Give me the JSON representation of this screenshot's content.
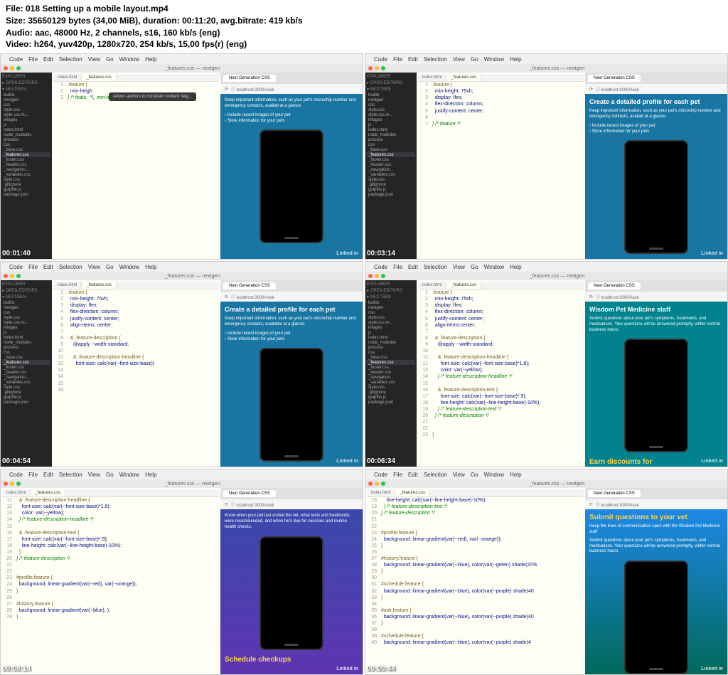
{
  "file_info": {
    "line1": "File: 018 Setting up a mobile layout.mp4",
    "line2": "Size: 35650129 bytes (34,00 MiB), duration: 00:11:20, avg.bitrate: 419 kb/s",
    "line3": "Audio: aac, 48000 Hz, 2 channels, s16, 160 kb/s (eng)",
    "line4": "Video: h264, yuv420p, 1280x720, 254 kb/s, 15,00 fps(r) (eng)"
  },
  "menu": [
    "Code",
    "File",
    "Edit",
    "Selection",
    "View",
    "Go",
    "Window",
    "Help"
  ],
  "window_title": "_features.css — nextgen",
  "sidebar": {
    "explorer": "EXPLORER",
    "open_editors": "OPEN EDITORS",
    "project": "NEXTGEN",
    "items": [
      "builds",
      "nextgen",
      "css",
      "style.css",
      "style.css.m...",
      "images",
      "js",
      "index.html",
      "node_modules",
      "process",
      "css",
      "_base.css",
      "_features.css",
      "_footer.css",
      "_header.css",
      "_navigation...",
      "_variables.css",
      "style.css",
      ".gitignore",
      "gulpfile.js",
      "package.json"
    ]
  },
  "tabs": {
    "html": "index.html",
    "css": "_features.css"
  },
  "browser": {
    "tab": "Next Generation CSS",
    "url": "localhost:3000/#ask"
  },
  "shots": [
    {
      "ts": "00:01:40",
      "code": [
        {
          "n": "1",
          "t": ".feature {",
          "c": "sel"
        },
        {
          "n": "2",
          "t": "  min-heigh",
          "c": "prop"
        },
        {
          "n": "3",
          "t": "} /* featu  🔧 min-height",
          "c": "com"
        }
      ],
      "tooltip": "Allows authors to constrain content heig...",
      "bcolor": "#1976a3",
      "bc_title": "",
      "bc_text": "Keep important information, such as your pet's microchip number and emergency contacts, availab at a glance.",
      "bc_list": [
        "Include recent images of your pet",
        "Store information for your pets"
      ]
    },
    {
      "ts": "00:03:14",
      "code": [
        {
          "n": "1",
          "t": ".feature {",
          "c": "sel"
        },
        {
          "n": "2",
          "t": "  min-height: 75vh;",
          "c": "prop"
        },
        {
          "n": "3",
          "t": "  display: flex;",
          "c": "prop"
        },
        {
          "n": "4",
          "t": "  flex-direction: column;",
          "c": "prop"
        },
        {
          "n": "5",
          "t": "  justify-content: center;",
          "c": "prop"
        },
        {
          "n": "6",
          "t": "",
          "c": ""
        },
        {
          "n": "7",
          "t": "} /* feature */",
          "c": "com"
        }
      ],
      "bcolor": "#1976a3",
      "bc_title": "Create a detailed profile for each pet",
      "bc_text": "Keep important information, such as your pet's microchip number and emergency contacts, availab at a glance.",
      "bc_list": [
        "Include recent images of your pet",
        "Store information for your pets"
      ]
    },
    {
      "ts": "00:04:54",
      "code": [
        {
          "n": "1",
          "t": ".feature {",
          "c": "sel"
        },
        {
          "n": "2",
          "t": "  min-height: 75vh;",
          "c": "prop"
        },
        {
          "n": "3",
          "t": "  display: flex;",
          "c": "prop"
        },
        {
          "n": "4",
          "t": "  flex-direction: column;",
          "c": "prop"
        },
        {
          "n": "5",
          "t": "  justify-content: center;",
          "c": "prop"
        },
        {
          "n": "6",
          "t": "  align-items: center;",
          "c": "prop"
        },
        {
          "n": "7",
          "t": "",
          "c": ""
        },
        {
          "n": "8",
          "t": "  & .feature-description {",
          "c": "sel"
        },
        {
          "n": "9",
          "t": "    @apply --width-standard;",
          "c": "prop"
        },
        {
          "n": "10",
          "t": "",
          "c": ""
        },
        {
          "n": "11",
          "t": "    & .feature-description-headline {",
          "c": "sel"
        },
        {
          "n": "12",
          "t": "      font-size: calc(var(--font-size-base))",
          "c": "prop"
        },
        {
          "n": "13",
          "t": "",
          "c": ""
        },
        {
          "n": "14",
          "t": "",
          "c": ""
        },
        {
          "n": "15",
          "t": "",
          "c": ""
        },
        {
          "n": "16",
          "t": "",
          "c": ""
        }
      ],
      "bcolor": "#1976a3",
      "bc_title": "Create a detailed profile for each pet",
      "bc_text": "Keep important information, such as your pet's microchip number and emergency contacts, available at a glance.",
      "bc_list": [
        "Include recent images of your pet",
        "Store information for your pets"
      ]
    },
    {
      "ts": "00:06:34",
      "code": [
        {
          "n": "1",
          "t": ".feature {",
          "c": "sel"
        },
        {
          "n": "2",
          "t": "  min-height: 75vh;",
          "c": "prop"
        },
        {
          "n": "3",
          "t": "  display: flex;",
          "c": "prop"
        },
        {
          "n": "4",
          "t": "  flex-direction: column;",
          "c": "prop"
        },
        {
          "n": "5",
          "t": "  justify-content: center;",
          "c": "prop"
        },
        {
          "n": "6",
          "t": "  align-items:center;",
          "c": "prop"
        },
        {
          "n": "7",
          "t": "",
          "c": ""
        },
        {
          "n": "8",
          "t": "  & .feature-description {",
          "c": "sel"
        },
        {
          "n": "9",
          "t": "    @apply --width-standard;",
          "c": "prop"
        },
        {
          "n": "10",
          "t": "",
          "c": ""
        },
        {
          "n": "11",
          "t": "    & .feature-description-headline {",
          "c": "sel"
        },
        {
          "n": "12",
          "t": "      font-size: calc(var(--font-size-base)*1.8);",
          "c": "prop"
        },
        {
          "n": "13",
          "t": "      color: var(--yellow);",
          "c": "prop"
        },
        {
          "n": "14",
          "t": "    } /* feature-description-headline */",
          "c": "com"
        },
        {
          "n": "15",
          "t": "",
          "c": ""
        },
        {
          "n": "16",
          "t": "    & .feature-description-text {",
          "c": "sel"
        },
        {
          "n": "17",
          "t": "      font-size: calc(var(--font-size-base)*.9);",
          "c": "prop"
        },
        {
          "n": "18",
          "t": "      line-height: calc(var(--line-height-base)-10%);",
          "c": "prop"
        },
        {
          "n": "19",
          "t": "    } /* feature-description-text */",
          "c": "com"
        },
        {
          "n": "20",
          "t": "  } /* feature-description */",
          "c": "com"
        },
        {
          "n": "21",
          "t": "",
          "c": ""
        },
        {
          "n": "22",
          "t": "",
          "c": ""
        },
        {
          "n": "23",
          "t": "}",
          "c": "sel"
        }
      ],
      "bcolor": "#00838f",
      "bc_title": "Wisdom Pet Medicine staff",
      "bc_text": "Submit questions about your pet's symptoms, treatments, and medications. Your questions will be answered promptly, within normal business hours.",
      "bc_list": [],
      "bc_footer": "Earn discounts for"
    },
    {
      "ts": "00:08:14",
      "no_sidebar": true,
      "code": [
        {
          "n": "11",
          "t": "  & .feature-description-headline {",
          "c": "sel"
        },
        {
          "n": "12",
          "t": "    font-size: calc(var(--font-size-base)*1.8);",
          "c": "prop"
        },
        {
          "n": "13",
          "t": "    color: var(--yellow);",
          "c": "prop"
        },
        {
          "n": "14",
          "t": "  } /* feature-description-headline */",
          "c": "com"
        },
        {
          "n": "15",
          "t": "",
          "c": ""
        },
        {
          "n": "16",
          "t": "  & .feature-description-text {",
          "c": "sel"
        },
        {
          "n": "17",
          "t": "    font-size: calc(var(--font-size-base)*.9);",
          "c": "prop"
        },
        {
          "n": "18",
          "t": "    line-height: calc(var(--line-height-base)-10%);",
          "c": "prop"
        },
        {
          "n": "19",
          "t": "  }",
          "c": "sel"
        },
        {
          "n": "20",
          "t": "} /* feature-description */",
          "c": "com"
        },
        {
          "n": "21",
          "t": "",
          "c": ""
        },
        {
          "n": "22",
          "t": "",
          "c": ""
        },
        {
          "n": "23",
          "t": "#profile.feature {",
          "c": "sel"
        },
        {
          "n": "24",
          "t": "  background: linear-gradient(var(--red), var(--orange));",
          "c": "prop"
        },
        {
          "n": "25",
          "t": "}",
          "c": "sel"
        },
        {
          "n": "26",
          "t": "",
          "c": ""
        },
        {
          "n": "27",
          "t": "#history.feature {",
          "c": "sel"
        },
        {
          "n": "28",
          "t": "  background: linear-gradient(var(--blue), );",
          "c": "prop"
        },
        {
          "n": "29",
          "t": "}",
          "c": "sel"
        }
      ],
      "bcolor": "linear-gradient(#3949ab,#5e35b1)",
      "bc_text": "Know when your pet last visited the vet, what tests and treatments were recommended, and when he's due for vaccines and routine health checks.",
      "bc_footer_yellow": "Schedule checkups"
    },
    {
      "ts": "00:09:44",
      "no_sidebar": true,
      "code": [
        {
          "n": "18",
          "t": "    line-height: calc(var(--line-height-base)-10%);",
          "c": "prop"
        },
        {
          "n": "19",
          "t": "  } /* feature-description-text */",
          "c": "com"
        },
        {
          "n": "20",
          "t": "} /* feature-description */",
          "c": "com"
        },
        {
          "n": "21",
          "t": "",
          "c": ""
        },
        {
          "n": "22",
          "t": "",
          "c": ""
        },
        {
          "n": "23",
          "t": "#profile.feature {",
          "c": "sel"
        },
        {
          "n": "24",
          "t": "  background: linear-gradient(var(--red), var(--orange));",
          "c": "prop"
        },
        {
          "n": "25",
          "t": "}",
          "c": "sel"
        },
        {
          "n": "26",
          "t": "",
          "c": ""
        },
        {
          "n": "27",
          "t": "#history.feature {",
          "c": "sel"
        },
        {
          "n": "28",
          "t": "  background: linear-gradient(var(--blue), color(var(--green) shade(20%",
          "c": "prop"
        },
        {
          "n": "29",
          "t": "}",
          "c": "sel"
        },
        {
          "n": "30",
          "t": "",
          "c": ""
        },
        {
          "n": "31",
          "t": "#schedule.feature {",
          "c": "sel"
        },
        {
          "n": "32",
          "t": "  background: linear-gradient(var(--blue), color(var(--purple) shade(40",
          "c": "prop"
        },
        {
          "n": "33",
          "t": "}",
          "c": "sel"
        },
        {
          "n": "34",
          "t": "",
          "c": ""
        },
        {
          "n": "35",
          "t": "#ask.feature {",
          "c": "sel"
        },
        {
          "n": "36",
          "t": "  background: linear-gradient(var(--blue), color(var(--purple) shade(40",
          "c": "prop"
        },
        {
          "n": "37",
          "t": "}",
          "c": "sel"
        },
        {
          "n": "38",
          "t": "",
          "c": ""
        },
        {
          "n": "39",
          "t": "#schedule.feature {",
          "c": "sel"
        },
        {
          "n": "40",
          "t": "  background: linear-gradient(var(--blue), color(var(--purple) shade(4",
          "c": "prop"
        }
      ],
      "bcolor": "linear-gradient(#1e88e5,#00695c)",
      "bc_title_yellow": "Submit questions to your vet",
      "bc_text": "Keep the lines of communication open with the Wisdom Pet Medicine staff",
      "bc_text2": "Submit questions about your pet's symptoms, treatments, and medications. Your questions will be answered promptly, within normal business hours."
    }
  ]
}
